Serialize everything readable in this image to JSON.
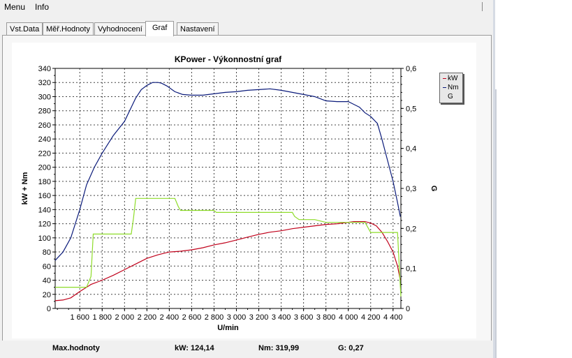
{
  "menu": {
    "items": [
      "Menu",
      "Info"
    ]
  },
  "tabs": [
    "Vst.Data",
    "Měř.Hodnoty",
    "Vyhodnocení",
    "Graf",
    "Nastavení"
  ],
  "active_tab": "Graf",
  "footer": {
    "label": "Max.hodnoty",
    "kw": "kW: 124,14",
    "nm": "Nm: 319,99",
    "g": "G: 0,27"
  },
  "colors": {
    "kw": "#c0001a",
    "nm": "#0a1a7a",
    "g": "#8edc2a"
  },
  "chart_data": {
    "type": "line",
    "title": "KPower - Výkonnostní graf",
    "xlabel": "U/min",
    "ylabel_left": "kW + Nm",
    "ylabel_right": "G",
    "xlim": [
      1380,
      4470
    ],
    "ylim_left": [
      0,
      340
    ],
    "ylim_right": [
      0,
      0.6
    ],
    "x_ticks": [
      "1 600",
      "1 800",
      "2 000",
      "2 200",
      "2 400",
      "2 600",
      "2 800",
      "3 000",
      "3 200",
      "3 400",
      "3 600",
      "3 800",
      "4 000",
      "4 200",
      "4 400"
    ],
    "y_ticks_left": [
      "0",
      "10",
      "20",
      "30",
      "40",
      "50",
      "60",
      "70",
      "80",
      "90",
      "100",
      "110",
      "120",
      "130",
      "140",
      "150",
      "160",
      "170",
      "180",
      "190",
      "200",
      "210",
      "220",
      "230",
      "240",
      "250",
      "260",
      "270",
      "280",
      "290",
      "300",
      "310",
      "320",
      "330",
      "340"
    ],
    "y_ticks_right": [
      "0",
      "0,1",
      "0,2",
      "0,3",
      "0,4",
      "0,5",
      "0,6"
    ],
    "grid": true,
    "legend": [
      "kW",
      "Nm",
      "G"
    ],
    "legend_position": "right",
    "series": [
      {
        "name": "Nm",
        "axis": "left",
        "x": [
          1380,
          1450,
          1520,
          1600,
          1660,
          1730,
          1800,
          1900,
          2000,
          2100,
          2150,
          2200,
          2250,
          2300,
          2330,
          2380,
          2450,
          2520,
          2600,
          2700,
          2800,
          2900,
          3000,
          3100,
          3200,
          3300,
          3400,
          3500,
          3600,
          3700,
          3800,
          3900,
          4000,
          4100,
          4150,
          4200,
          4260,
          4300,
          4350,
          4400,
          4440,
          4465
        ],
        "y": [
          68,
          80,
          100,
          140,
          175,
          200,
          220,
          245,
          265,
          298,
          310,
          316,
          320,
          320,
          319,
          315,
          307,
          303,
          302,
          302,
          304,
          306,
          307,
          309,
          310,
          311,
          309,
          306,
          303,
          300,
          294,
          293,
          293,
          285,
          277,
          272,
          262,
          240,
          210,
          180,
          150,
          130
        ]
      },
      {
        "name": "kW",
        "axis": "left",
        "x": [
          1380,
          1450,
          1520,
          1600,
          1700,
          1800,
          1900,
          2000,
          2100,
          2200,
          2300,
          2400,
          2500,
          2600,
          2700,
          2800,
          2900,
          3000,
          3100,
          3200,
          3300,
          3400,
          3500,
          3600,
          3700,
          3800,
          3900,
          4000,
          4050,
          4100,
          4150,
          4200,
          4250,
          4300,
          4350,
          4400,
          4440,
          4465
        ],
        "y": [
          11,
          12,
          15,
          24,
          34,
          40,
          47,
          55,
          63,
          71,
          76,
          80,
          81,
          83,
          86,
          90,
          93,
          97,
          101,
          105,
          108,
          110,
          113,
          115,
          117,
          119,
          120,
          122,
          123,
          123,
          123,
          121,
          117,
          108,
          95,
          80,
          60,
          40
        ]
      },
      {
        "name": "G",
        "axis": "right",
        "x": [
          1380,
          1640,
          1660,
          1700,
          1720,
          1800,
          1900,
          2000,
          2020,
          2060,
          2080,
          2100,
          2200,
          2300,
          2400,
          2450,
          2480,
          2500,
          2520,
          2600,
          2700,
          2800,
          2820,
          2860,
          2900,
          3000,
          3100,
          3200,
          3300,
          3400,
          3500,
          3520,
          3560,
          3600,
          3700,
          3800,
          3900,
          4000,
          4100,
          4150,
          4200,
          4220,
          4300,
          4400,
          4420,
          4440,
          4460,
          4470
        ],
        "y": [
          0.053,
          0.053,
          0.053,
          0.08,
          0.186,
          0.186,
          0.186,
          0.186,
          0.186,
          0.186,
          0.225,
          0.275,
          0.275,
          0.275,
          0.275,
          0.275,
          0.255,
          0.245,
          0.245,
          0.245,
          0.245,
          0.245,
          0.24,
          0.24,
          0.24,
          0.24,
          0.24,
          0.24,
          0.24,
          0.24,
          0.24,
          0.23,
          0.222,
          0.222,
          0.222,
          0.215,
          0.215,
          0.215,
          0.215,
          0.215,
          0.19,
          0.19,
          0.19,
          0.19,
          0.19,
          0.19,
          0.08,
          0.03
        ]
      }
    ]
  }
}
